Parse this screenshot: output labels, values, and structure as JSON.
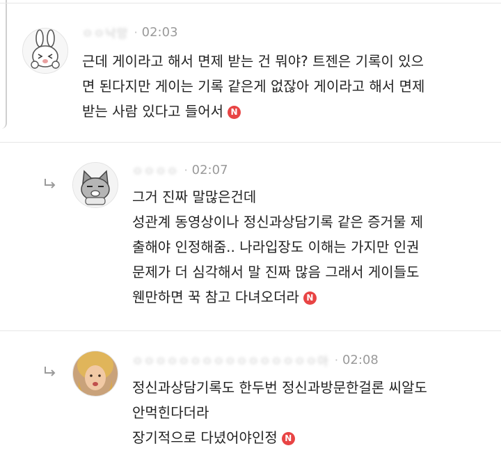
{
  "comments": [
    {
      "author": "ㅇㅇ낙망",
      "time": "02:03",
      "lines": [
        "근데 게이라고 해서 면제 받는 건 뭐야? 트젠은 기록이 있으",
        "면 된다지만 게이는 기록 같은게 없잖아 게이라고 해서 면제",
        "받는 사람 있다고 들어서"
      ],
      "badge": "N"
    },
    {
      "author": "ㅇㅇㅇㅇ",
      "time": "02:07",
      "lines": [
        "그거 진짜 말많은건데",
        "성관계 동영상이나 정신과상담기록 같은 증거물 제",
        "출해야 인정해줌.. 나라입장도 이해는 가지만 인권",
        "문제가 더 심각해서 말 진짜 많음 그래서 게이들도",
        "웬만하면 꾹 참고 다녀오더라"
      ],
      "badge": "N"
    },
    {
      "author": "ㅇㅇㅇㅇㅇㅇㅇㅇㅇㅇㅇㅇㅇㅇㅇㅇ아",
      "time": "02:08",
      "lines": [
        "정신과상담기록도 한두번 정신과방문한걸론 씨알도",
        "안먹힌다더라",
        "장기적으로 다녔어야인정"
      ],
      "badge": "N"
    }
  ]
}
